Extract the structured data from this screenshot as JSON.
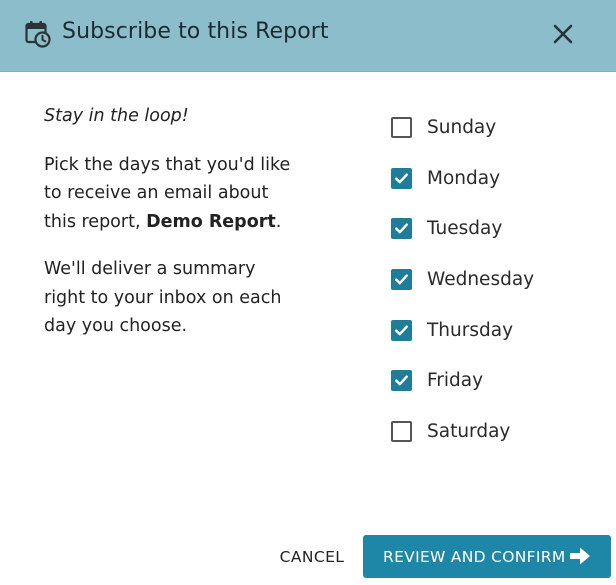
{
  "dialog": {
    "title": "Subscribe to this Report",
    "header_icon": "calendar-clock-icon",
    "close_icon": "close-icon"
  },
  "intro": {
    "lead": "Stay in the loop!",
    "paragraph1_prefix": "Pick the days that you'd like to receive an email about this report, ",
    "report_name": "Demo Report",
    "paragraph1_suffix": ".",
    "paragraph2": "We'll deliver a summary right to your inbox on each day you choose."
  },
  "days": [
    {
      "label": "Sunday",
      "checked": false
    },
    {
      "label": "Monday",
      "checked": true
    },
    {
      "label": "Tuesday",
      "checked": true
    },
    {
      "label": "Wednesday",
      "checked": true
    },
    {
      "label": "Thursday",
      "checked": true
    },
    {
      "label": "Friday",
      "checked": true
    },
    {
      "label": "Saturday",
      "checked": false
    }
  ],
  "actions": {
    "cancel_label": "CANCEL",
    "confirm_label": "REVIEW AND CONFIRM",
    "confirm_icon": "arrow-right-icon"
  },
  "colors": {
    "header_bg": "#8cbdcb",
    "accent": "#1e86a6",
    "checkbox_checked": "#1f7d99"
  }
}
